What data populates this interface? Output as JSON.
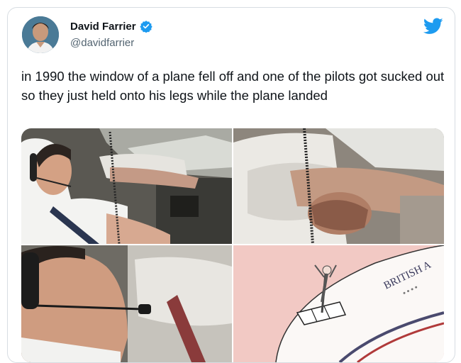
{
  "tweet": {
    "author_name": "David Farrier",
    "handle": "@davidfarrier",
    "text": "in 1990 the window of a plane fell off and one of the pilots got sucked out so they just held onto his legs while the plane landed",
    "verified": true
  },
  "icons": {
    "verified": "verified-badge-icon",
    "logo": "twitter-bird-icon"
  },
  "media": {
    "photos": [
      {
        "name": "pilot-in-cockpit-photo"
      },
      {
        "name": "pilot-pressed-against-window-photo"
      },
      {
        "name": "pilot-closeup-photo"
      },
      {
        "name": "british-airways-plane-drawing",
        "text": "BRITISH A"
      }
    ]
  },
  "colors": {
    "twitter_blue": "#1d9bf0",
    "text": "#0f1419",
    "secondary_text": "#536471"
  }
}
